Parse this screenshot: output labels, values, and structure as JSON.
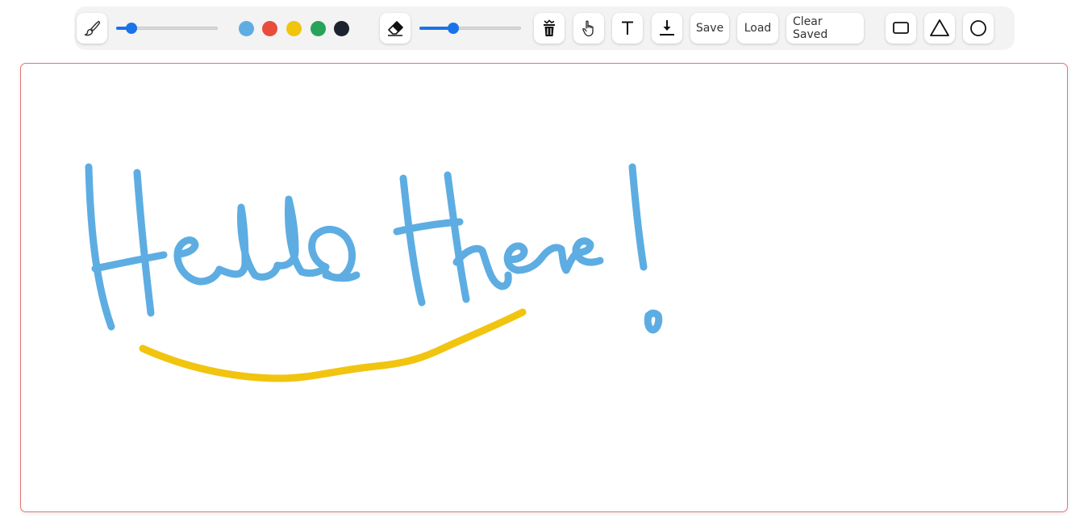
{
  "toolbar": {
    "brush_icon": "brush-icon",
    "brush_size_percent": 15,
    "colors": [
      {
        "name": "blue",
        "hex": "#5dade2"
      },
      {
        "name": "red",
        "hex": "#e74c3c"
      },
      {
        "name": "yellow",
        "hex": "#f1c40f"
      },
      {
        "name": "green",
        "hex": "#27a35a"
      },
      {
        "name": "black",
        "hex": "#1c2230"
      }
    ],
    "eraser_icon": "eraser-icon",
    "eraser_size_percent": 33,
    "tools": {
      "trash_icon": "trash-icon",
      "hand_icon": "hand-pointer-icon",
      "text_icon": "text-tool-icon",
      "download_icon": "download-icon"
    },
    "save_label": "Save",
    "load_label": "Load",
    "clear_saved_label": "Clear Saved",
    "shapes": {
      "rectangle_icon": "rectangle-icon",
      "triangle_icon": "triangle-icon",
      "circle_icon": "circle-icon"
    }
  },
  "canvas": {
    "handwriting_text": "Hello there!",
    "stroke_colors": {
      "text": "#5dade2",
      "underline": "#f1c40f"
    },
    "border_color": "#e57373"
  }
}
